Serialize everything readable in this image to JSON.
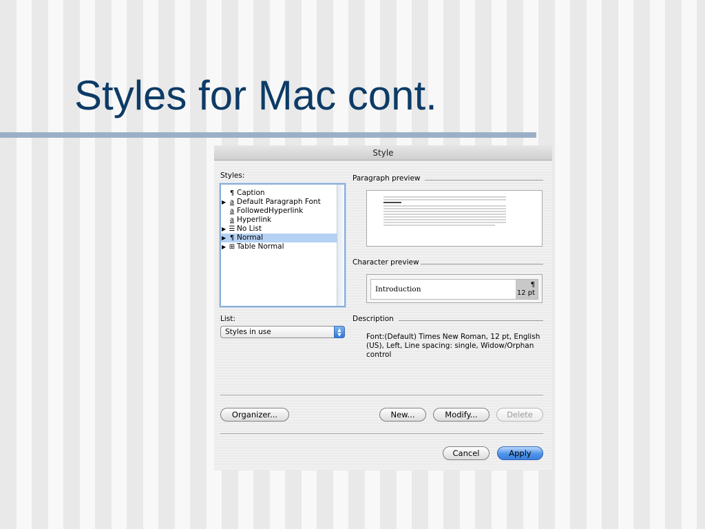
{
  "slide": {
    "title": "Styles for Mac cont."
  },
  "dialog": {
    "title": "Style",
    "styles_label": "Styles:",
    "styles": [
      {
        "label": "Caption",
        "glyph": "¶",
        "expand": ""
      },
      {
        "label": "Default Paragraph Font",
        "glyph": "a",
        "expand": "▶"
      },
      {
        "label": "FollowedHyperlink",
        "glyph": "a",
        "expand": ""
      },
      {
        "label": "Hyperlink",
        "glyph": "a",
        "expand": ""
      },
      {
        "label": "No List",
        "glyph": "☰",
        "expand": "▶"
      },
      {
        "label": "Normal",
        "glyph": "¶",
        "expand": "▶",
        "selected": true
      },
      {
        "label": "Table Normal",
        "glyph": "⊞",
        "expand": "▶"
      }
    ],
    "list_label": "List:",
    "list_value": "Styles in use",
    "paragraph_preview_label": "Paragraph preview",
    "character_preview_label": "Character preview",
    "character_preview_text": "Introduction",
    "character_preview_mark": "¶",
    "character_preview_size": "12 pt",
    "description_label": "Description",
    "description_text": "Font:(Default) Times New Roman, 12 pt, English (US), Left, Line spacing:  single, Widow/Orphan control",
    "buttons": {
      "organizer": "Organizer...",
      "new": "New...",
      "modify": "Modify...",
      "delete": "Delete",
      "cancel": "Cancel",
      "apply": "Apply"
    },
    "icons": {
      "expand": "disclosure-triangle-icon",
      "popup": "popup-arrows-icon"
    }
  }
}
